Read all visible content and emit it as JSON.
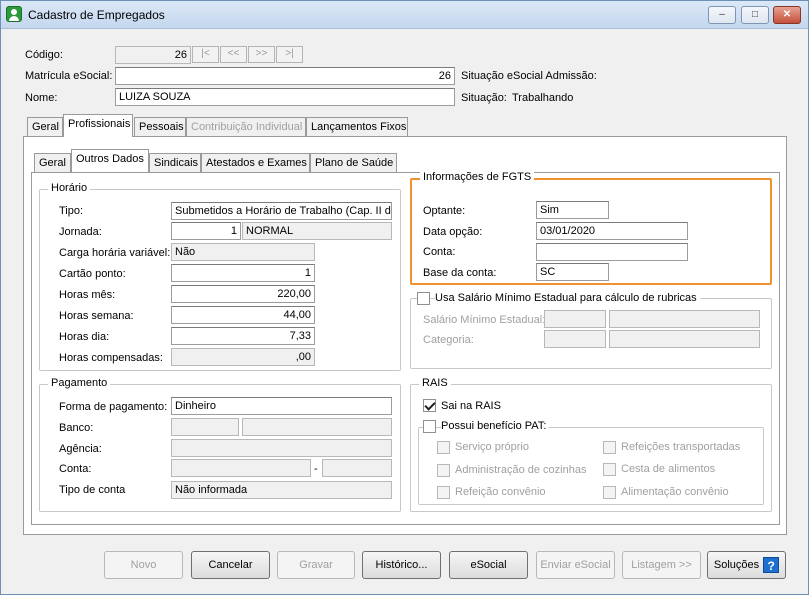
{
  "window": {
    "title": "Cadastro de Empregados",
    "minimize_glyph": "–",
    "maximize_glyph": "□",
    "close_glyph": "✕"
  },
  "header": {
    "codigo_label": "Código:",
    "codigo_value": "26",
    "nav": [
      "|<",
      "<<",
      ">>",
      ">|"
    ],
    "matricula_label": "Matrícula eSocial:",
    "matricula_value": "26",
    "situacao_admissao_label": "Situação eSocial Admissão:",
    "nome_label": "Nome:",
    "nome_value": "LUIZA SOUZA",
    "situacao_label": "Situação:",
    "situacao_value": "Trabalhando"
  },
  "main_tabs": [
    "Geral",
    "Profissionais",
    "Pessoais",
    "Contribuição Individual",
    "Lançamentos Fixos"
  ],
  "sub_tabs": [
    "Geral",
    "Outros Dados",
    "Sindicais",
    "Atestados e Exames",
    "Plano de Saúde"
  ],
  "horario": {
    "title": "Horário",
    "tipo_label": "Tipo:",
    "tipo_value": "Submetidos a Horário de Trabalho (Cap. II da C",
    "jornada_label": "Jornada:",
    "jornada_code": "1",
    "jornada_name": "NORMAL",
    "carga_label": "Carga horária variável:",
    "carga_value": "Não",
    "cartao_label": "Cartão ponto:",
    "cartao_value": "1",
    "horas_mes_label": "Horas mês:",
    "horas_mes_value": "220,00",
    "horas_semana_label": "Horas semana:",
    "horas_semana_value": "44,00",
    "horas_dia_label": "Horas dia:",
    "horas_dia_value": "7,33",
    "horas_comp_label": "Horas compensadas:",
    "horas_comp_value": ",00"
  },
  "pagamento": {
    "title": "Pagamento",
    "forma_label": "Forma de pagamento:",
    "forma_value": "Dinheiro",
    "banco_label": "Banco:",
    "agencia_label": "Agência:",
    "conta_label": "Conta:",
    "conta_sep": "-",
    "tipo_conta_label": "Tipo de conta",
    "tipo_conta_value": "Não informada"
  },
  "fgts": {
    "title": "Informações de FGTS",
    "optante_label": "Optante:",
    "optante_value": "Sim",
    "data_label": "Data opção:",
    "data_value": "03/01/2020",
    "conta_label": "Conta:",
    "conta_value": "",
    "base_label": "Base da conta:",
    "base_value": "SC"
  },
  "salario": {
    "title": "Usa Salário Mínimo Estadual para cálculo de rubricas",
    "salario_label": "Salário Mínimo Estadual:",
    "categoria_label": "Categoria:"
  },
  "rais": {
    "title": "RAIS",
    "sai_na_rais": "Sai na RAIS",
    "pat_title": "Possui benefício PAT:",
    "pat_options": [
      "Serviço próprio",
      "Refeições transportadas",
      "Administração de cozinhas",
      "Cesta de alimentos",
      "Refeição convênio",
      "Alimentação convênio"
    ]
  },
  "buttons": {
    "novo": "Novo",
    "cancelar": "Cancelar",
    "gravar": "Gravar",
    "historico": "Histórico...",
    "esocial": "eSocial",
    "enviar_esocial": "Enviar eSocial",
    "listagem": "Listagem >>",
    "solucoes": "Soluções",
    "help_glyph": "?"
  },
  "colors": {
    "fgts_highlight": "#f0922e",
    "help_icon": "#1e6fd0"
  }
}
